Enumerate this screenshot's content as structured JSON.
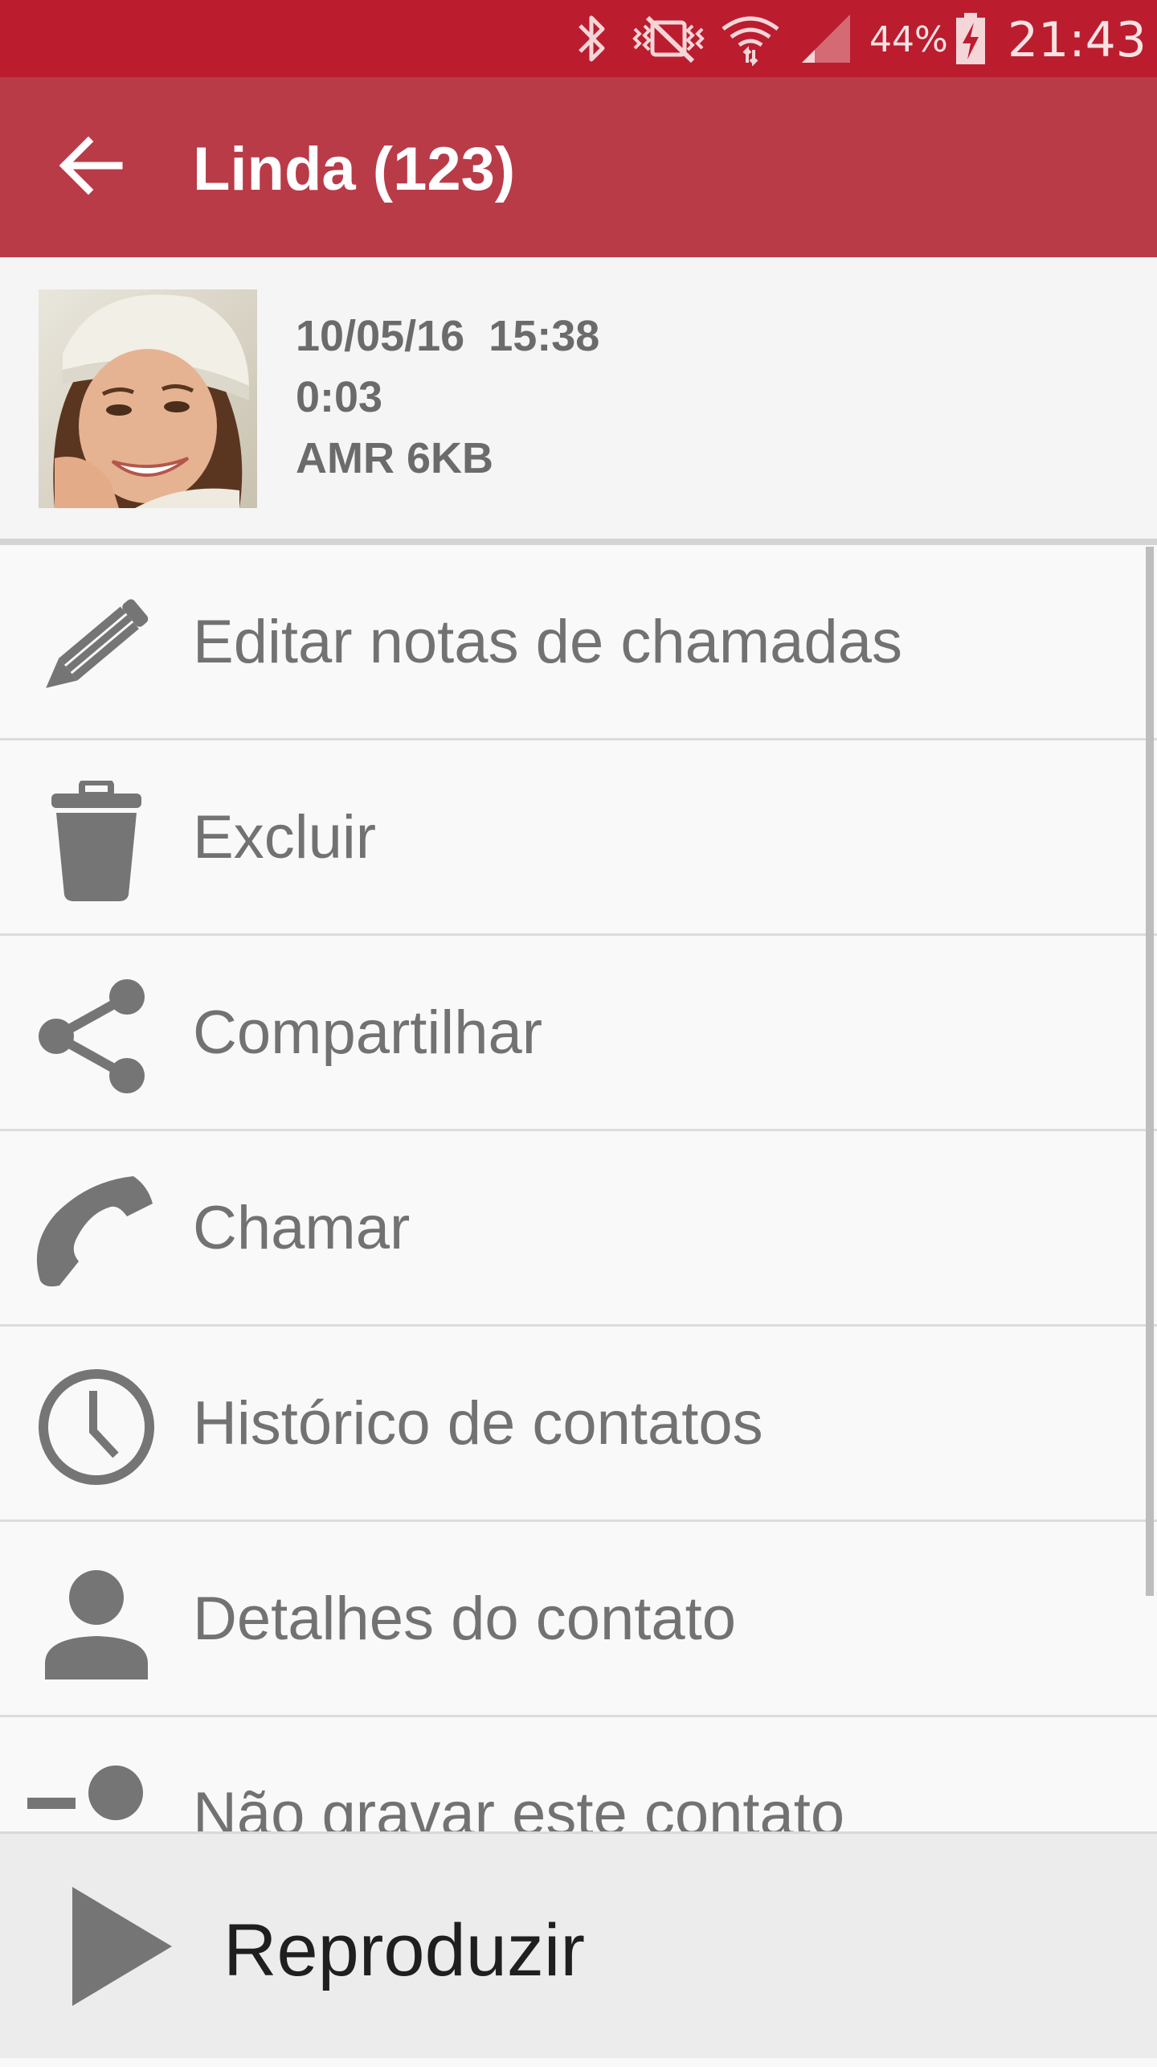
{
  "status_bar": {
    "battery_percent": "44%",
    "time": "21:43",
    "icons": [
      "bluetooth-icon",
      "vibrate-mute-icon",
      "wifi-icon",
      "signal-icon",
      "battery-charging-icon"
    ]
  },
  "app_bar": {
    "title": "Linda (123)",
    "back_icon": "arrow-back-icon"
  },
  "recording": {
    "date_time": "10/05/16  15:38",
    "duration": "0:03",
    "format_size": "AMR 6KB"
  },
  "actions": [
    {
      "label": "Editar notas de chamadas",
      "icon": "pencil-icon"
    },
    {
      "label": "Excluir",
      "icon": "trash-icon"
    },
    {
      "label": "Compartilhar",
      "icon": "share-icon"
    },
    {
      "label": "Chamar",
      "icon": "phone-icon"
    },
    {
      "label": "Histórico de contatos",
      "icon": "clock-icon"
    },
    {
      "label": "Detalhes do contato",
      "icon": "person-icon"
    },
    {
      "label": "Não gravar este contato",
      "icon": "person-remove-icon"
    }
  ],
  "player": {
    "play_label": "Reproduzir",
    "play_icon": "play-icon"
  },
  "colors": {
    "status_bar": "#bb1d2e",
    "app_bar": "#b93b48",
    "icon_gray": "#757575",
    "text_gray": "#727272"
  }
}
